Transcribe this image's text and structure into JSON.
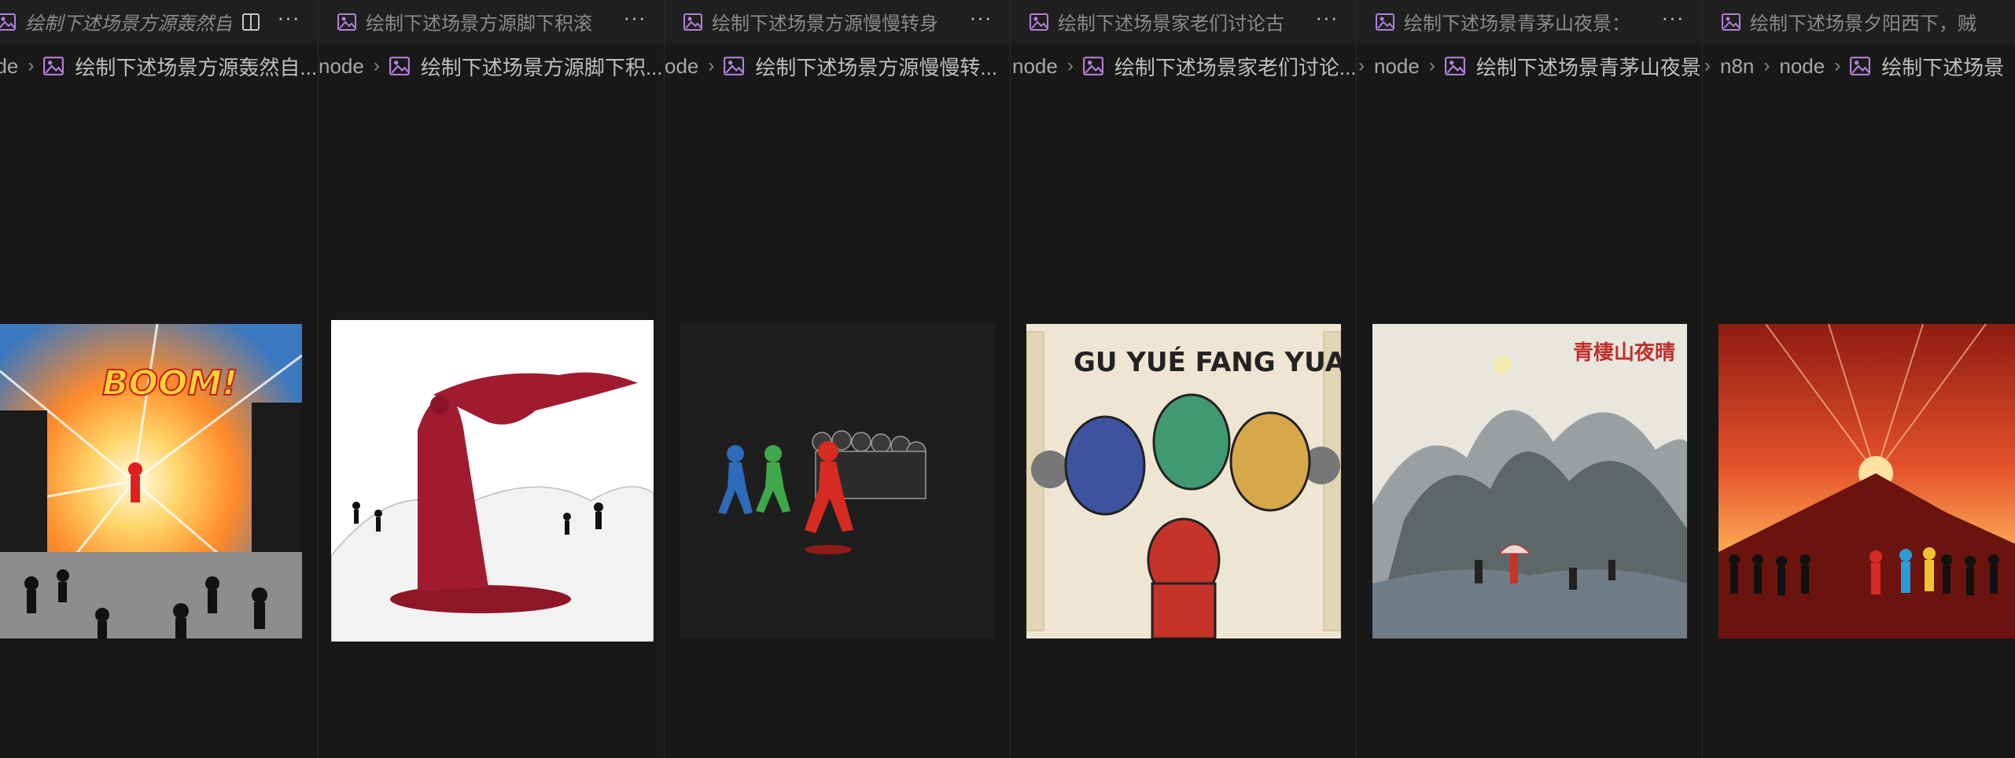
{
  "panes": [
    {
      "tab_title": "绘制下述场景方源轰然自",
      "active": true,
      "crumbs": [
        "ode"
      ],
      "file_crumb": "绘制下述场景方源轰然自...",
      "art_caption": "BOOM!"
    },
    {
      "tab_title": "绘制下述场景方源脚下积滚",
      "active": false,
      "crumbs": [
        "node"
      ],
      "file_crumb": "绘制下述场景方源脚下积..."
    },
    {
      "tab_title": "绘制下述场景方源慢慢转身",
      "active": false,
      "crumbs": [
        "ode"
      ],
      "file_crumb": "绘制下述场景方源慢慢转..."
    },
    {
      "tab_title": "绘制下述场景家老们讨论古",
      "active": false,
      "crumbs": [
        "node"
      ],
      "file_crumb": "绘制下述场景家老们讨论...",
      "art_caption": "GU YUÉ FANG YUAN"
    },
    {
      "tab_title": "绘制下述场景青茅山夜景：",
      "active": false,
      "crumbs": [
        "node"
      ],
      "file_crumb": "绘制下述场景青茅山夜景",
      "art_caption": "青棲山夜晴"
    },
    {
      "tab_title": "绘制下述场景夕阳西下，贼",
      "active": false,
      "crumbs": [
        "n8n",
        "node"
      ],
      "file_crumb": "绘制下述场景"
    }
  ],
  "icons": {
    "image_file": "image-file-icon",
    "split": "split-editor-icon",
    "more": "more-actions-icon",
    "chevron": "chevron-right-icon"
  },
  "more_glyph": "···",
  "chevron_glyph": "›",
  "colors": {
    "background": "#181818",
    "tab_background": "#1f1f1f",
    "icon_purple": "#b180d7",
    "text_muted": "#8b8b8b"
  }
}
